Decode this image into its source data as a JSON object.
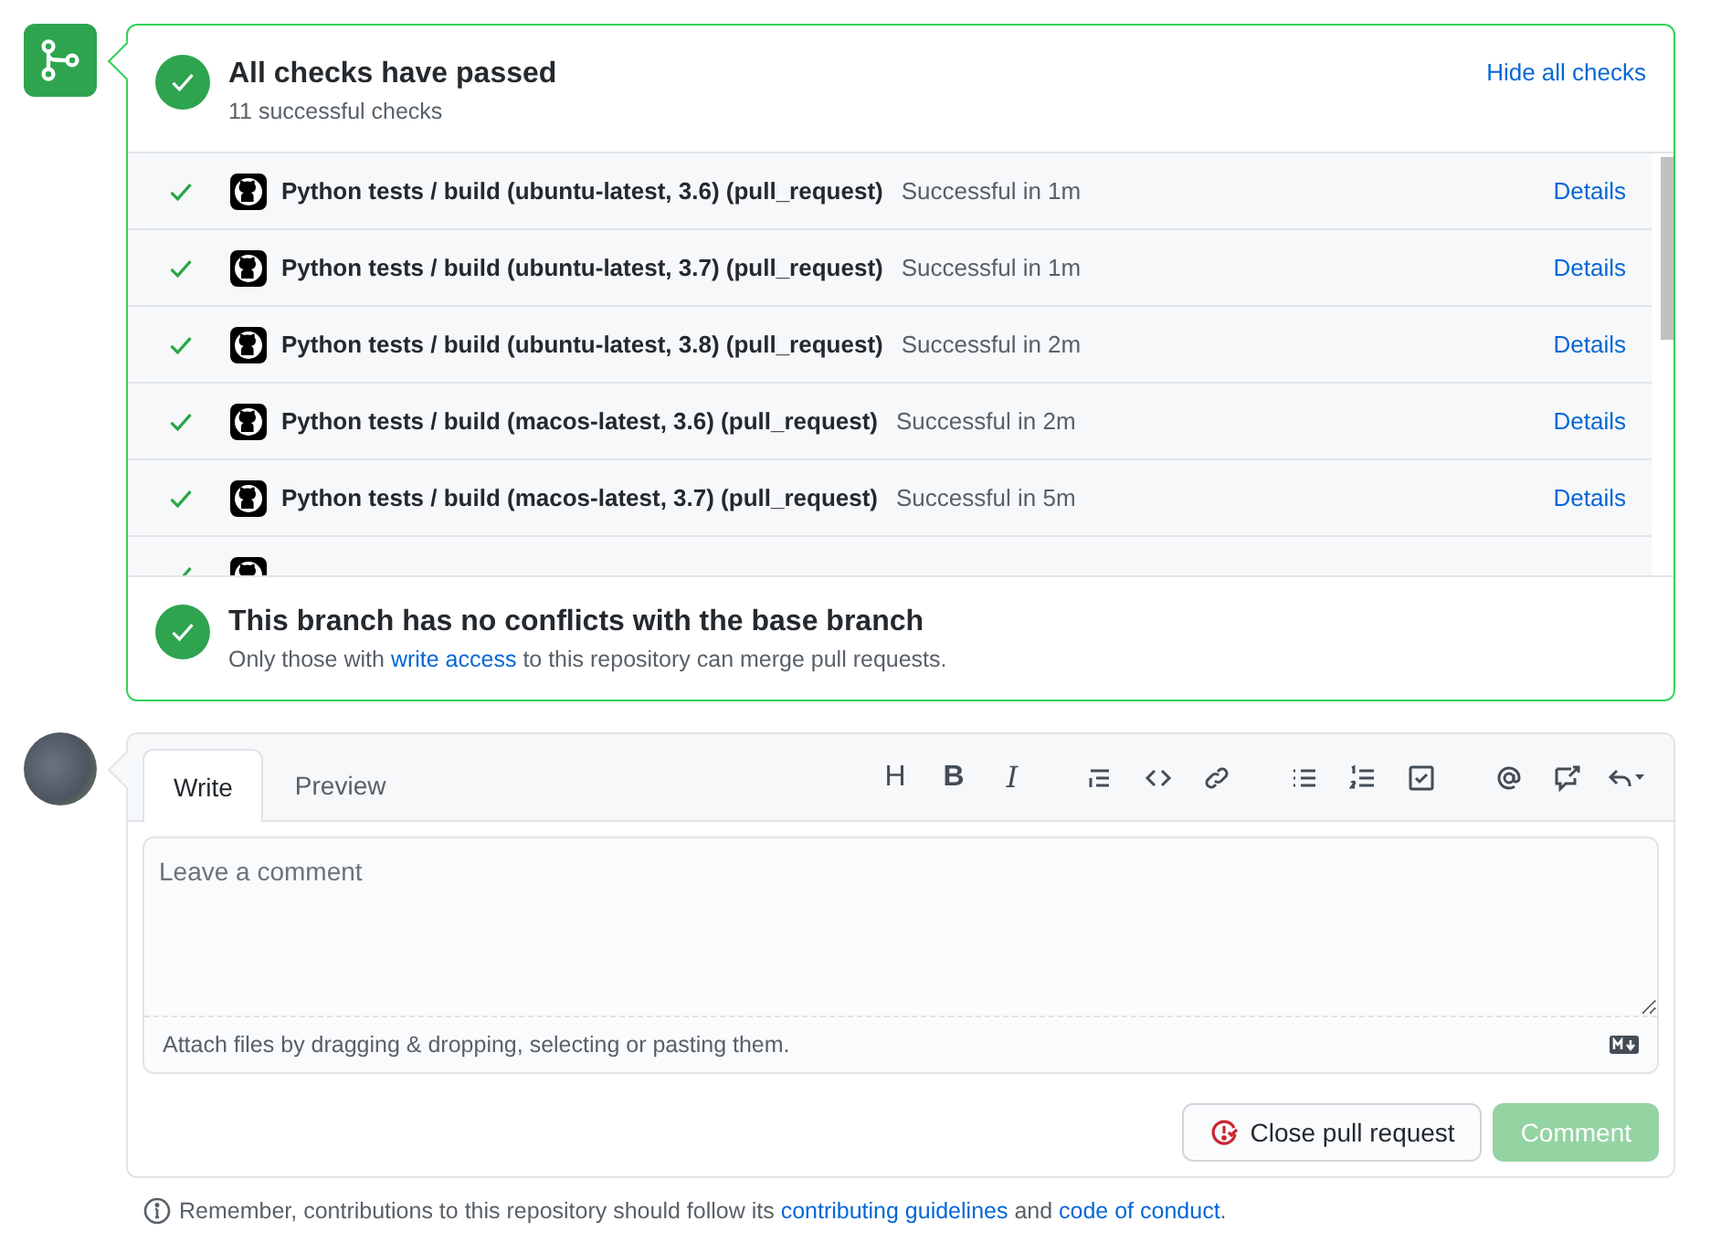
{
  "merge_box": {
    "title": "All checks have passed",
    "subtitle": "11 successful checks",
    "toggle_link": "Hide all checks",
    "checks": [
      {
        "name": "Python tests / build (ubuntu-latest, 3.6) (pull_request)",
        "status": "Successful in 1m",
        "link": "Details",
        "passed": true
      },
      {
        "name": "Python tests / build (ubuntu-latest, 3.7) (pull_request)",
        "status": "Successful in 1m",
        "link": "Details",
        "passed": true
      },
      {
        "name": "Python tests / build (ubuntu-latest, 3.8) (pull_request)",
        "status": "Successful in 2m",
        "link": "Details",
        "passed": true
      },
      {
        "name": "Python tests / build (macos-latest, 3.6) (pull_request)",
        "status": "Successful in 2m",
        "link": "Details",
        "passed": true
      },
      {
        "name": "Python tests / build (macos-latest, 3.7) (pull_request)",
        "status": "Successful in 5m",
        "link": "Details",
        "passed": true
      },
      {
        "passed": true
      }
    ],
    "branch_status": {
      "title": "This branch has no conflicts with the base branch",
      "text_before": "Only those with ",
      "link": "write access",
      "text_after": " to this repository can merge pull requests."
    }
  },
  "comment_form": {
    "tabs": [
      {
        "label": "Write",
        "selected": true
      },
      {
        "label": "Preview",
        "selected": false
      }
    ],
    "toolbar": [
      {
        "items": [
          {
            "kind": "heading",
            "glyph": "H"
          },
          {
            "kind": "bold",
            "glyph": "B"
          },
          {
            "kind": "italic",
            "glyph": "I"
          }
        ]
      },
      {
        "items": [
          {
            "kind": "quote"
          },
          {
            "kind": "code"
          },
          {
            "kind": "link"
          }
        ]
      },
      {
        "items": [
          {
            "kind": "bullet-list"
          },
          {
            "kind": "numbered-list"
          },
          {
            "kind": "task-list"
          }
        ]
      },
      {
        "items": [
          {
            "kind": "mention"
          },
          {
            "kind": "reference"
          },
          {
            "kind": "reply"
          }
        ]
      }
    ],
    "placeholder": "Leave a comment",
    "attach_hint": "Attach files by dragging & dropping, selecting or pasting them.",
    "close_button": "Close pull request",
    "comment_button": {
      "label": "Comment",
      "disabled": true
    }
  },
  "footer_note": {
    "before": "Remember, contributions to this repository should follow its ",
    "link_1": "contributing guidelines",
    "middle": " and ",
    "link_2": "code of conduct",
    "after": "."
  }
}
